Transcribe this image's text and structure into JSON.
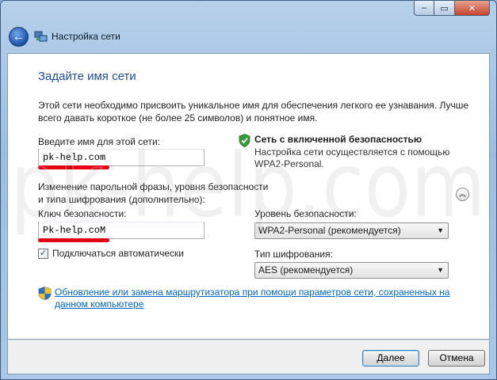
{
  "window": {
    "title": "Настройка сети",
    "minimize": "–",
    "maximize": "▭",
    "close": "✕"
  },
  "page": {
    "heading": "Задайте имя сети",
    "description": "Этой сети необходимо присвоить уникальное имя для обеспечения легкого ее узнавания. Лучше всего давать короткое (не более 25 символов) и понятное имя."
  },
  "network_name": {
    "label": "Введите имя для этой сети:",
    "value": "pk-help.com"
  },
  "security_status": {
    "title": "Сеть с включенной безопасностью",
    "description_line1": "Настройка сети осуществляется с помощью",
    "description_line2": "WPA2-Personal."
  },
  "passphrase_section": {
    "label_line1": "Изменение парольной фразы, уровня безопасности",
    "label_line2": "и типа шифрования (дополнительно):"
  },
  "security_key": {
    "label": "Ключ безопасности:",
    "value": "Pk-help.coM"
  },
  "security_level": {
    "label": "Уровень безопасности:",
    "selected": "WPA2-Personal (рекомендуется)"
  },
  "encryption_type": {
    "label": "Тип шифрования:",
    "selected": "AES (рекомендуется)"
  },
  "auto_connect": {
    "label": "Подключаться автоматически",
    "checked": true
  },
  "router_link": {
    "text": "Обновление или замена маршрутизатора при помощи параметров сети, сохраненных на данном компьютере"
  },
  "buttons": {
    "next": "Далее",
    "cancel": "Отмена"
  },
  "watermark": "pk-help.com",
  "colors": {
    "accent": "#1e4e99",
    "link": "#0066cc",
    "highlight": "#e50014"
  }
}
